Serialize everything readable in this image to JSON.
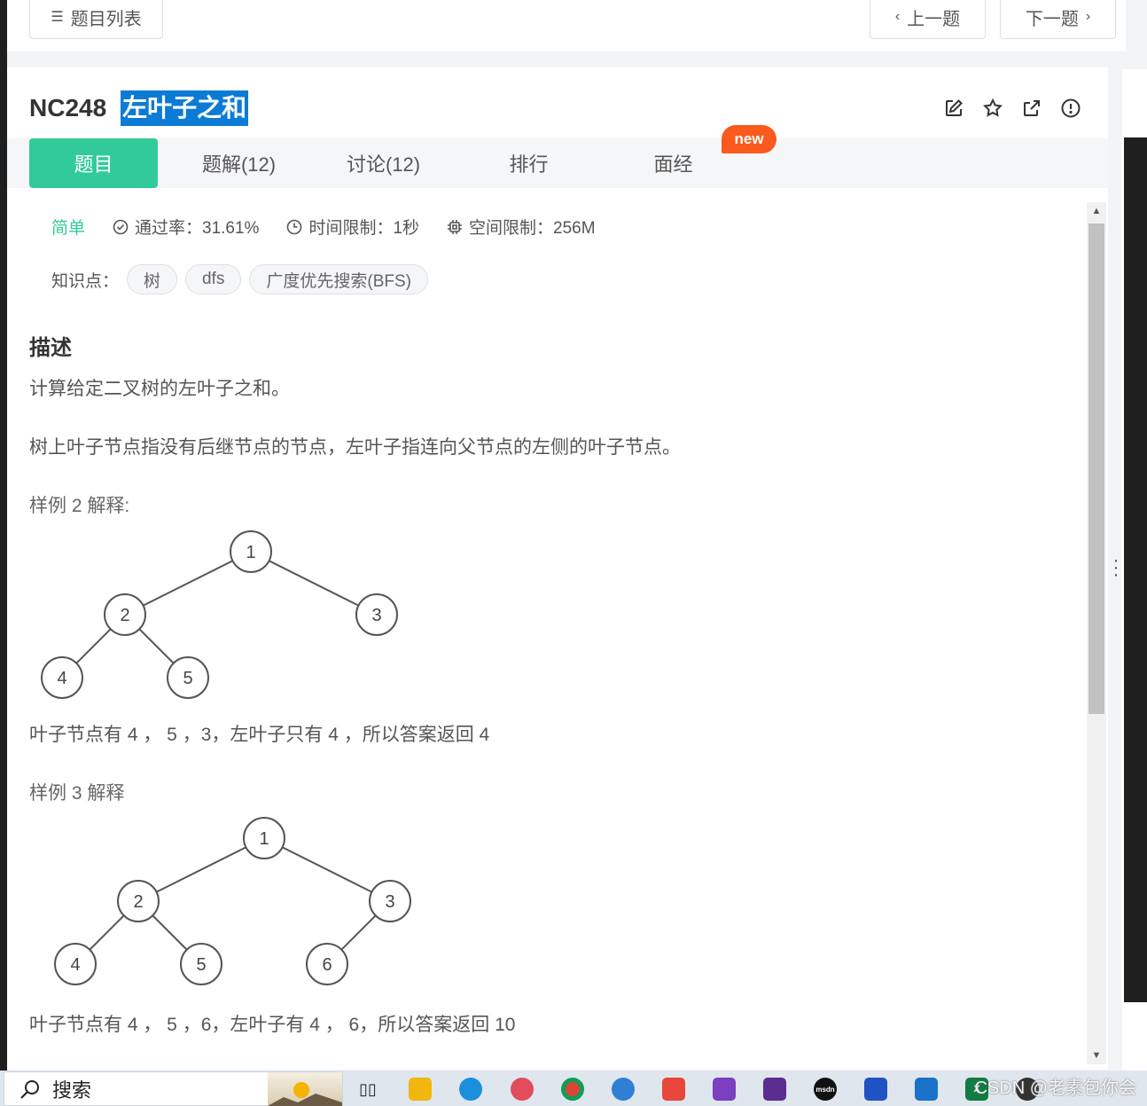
{
  "topbar": {
    "problem_list": "题目列表",
    "prev": "上一题",
    "next": "下一题"
  },
  "problem": {
    "id": "NC248",
    "title": "左叶子之和"
  },
  "tabs": [
    {
      "label": "题目"
    },
    {
      "label": "题解(12)"
    },
    {
      "label": "讨论(12)"
    },
    {
      "label": "排行"
    },
    {
      "label": "面经"
    }
  ],
  "new_badge": "new",
  "meta": {
    "difficulty": "简单",
    "pass_rate": "通过率：31.61%",
    "time_limit": "时间限制：1秒",
    "space_limit": "空间限制：256M"
  },
  "knowledge": {
    "label": "知识点：",
    "tags": [
      "树",
      "dfs",
      "广度优先搜索(BFS)"
    ]
  },
  "description": {
    "heading": "描述",
    "line1": "计算给定二叉树的左叶子之和。",
    "line2": "树上叶子节点指没有后继节点的节点，左叶子指连向父节点的左侧的叶子节点。",
    "example2_label": "样例 2 解释:",
    "example2_nodes": [
      "1",
      "2",
      "3",
      "4",
      "5"
    ],
    "example2_text": "叶子节点有 4 ， 5 ，3，左叶子只有 4 ，所以答案返回 4",
    "example3_label": "样例 3 解释",
    "example3_nodes": [
      "1",
      "2",
      "3",
      "4",
      "5",
      "6"
    ],
    "example3_text": "叶子节点有 4 ， 5 ，6，左叶子有 4 ， 6，所以答案返回 10"
  },
  "taskbar": {
    "search": "搜索",
    "watermark": "CSDN @老素包你会"
  },
  "colors": {
    "accent": "#32ca99",
    "badge": "#fa5a1e",
    "highlight": "#0c7bd6"
  }
}
